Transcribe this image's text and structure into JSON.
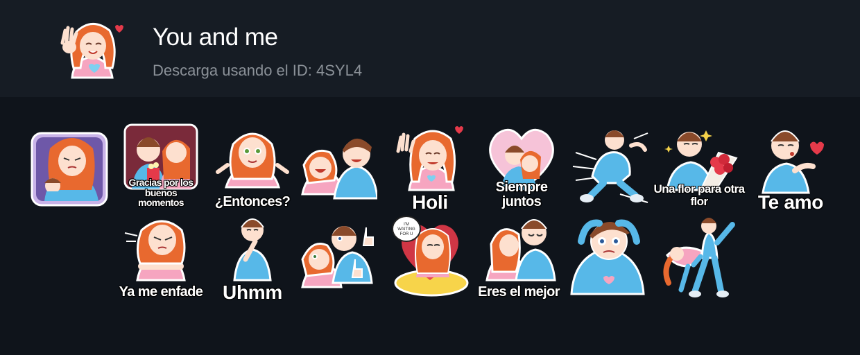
{
  "header": {
    "title": "You and me",
    "subtitle": "Descarga usando el ID: 4SYL4",
    "icon": "waving-girl-sticker-icon"
  },
  "colors": {
    "background": "#0f141b",
    "header_background": "#161c24",
    "hoodie_blue": "#57b8e8",
    "hoodie_pink": "#f6a5c0",
    "hair_red": "#e8692f",
    "hair_brown": "#8a4a2a",
    "heart_red": "#e53a4a"
  },
  "stickers": [
    {
      "caption": "",
      "icon": "girl-holding-boy-sticker"
    },
    {
      "caption": "Gracias por los buenos momentos",
      "icon": "couple-cinema-sticker"
    },
    {
      "caption": "¿Entonces?",
      "icon": "girl-shrug-sticker"
    },
    {
      "caption": "",
      "icon": "couple-laughing-sticker"
    },
    {
      "caption": "Holi",
      "icon": "girl-waving-sticker"
    },
    {
      "caption": "Siempre juntos",
      "icon": "couple-heart-sticker"
    },
    {
      "caption": "",
      "icon": "boy-running-sticker"
    },
    {
      "caption": "Una flor para otra flor",
      "icon": "boy-flowers-sticker"
    },
    {
      "caption": "Te amo",
      "icon": "boy-blowing-kiss-sticker"
    },
    {
      "caption": "Ya me enfade",
      "icon": "girl-angry-sticker"
    },
    {
      "caption": "Uhmm",
      "icon": "boy-thinking-sticker"
    },
    {
      "caption": "",
      "icon": "couple-thumbs-up-sticker"
    },
    {
      "caption": "",
      "icon": "girl-waiting-sticker",
      "bubble": "I'M WAITING FOR U"
    },
    {
      "caption": "Eres el mejor",
      "icon": "couple-kiss-sticker"
    },
    {
      "caption": "",
      "icon": "boy-shocked-sticker"
    },
    {
      "caption": "",
      "icon": "couple-dancing-sticker"
    }
  ]
}
